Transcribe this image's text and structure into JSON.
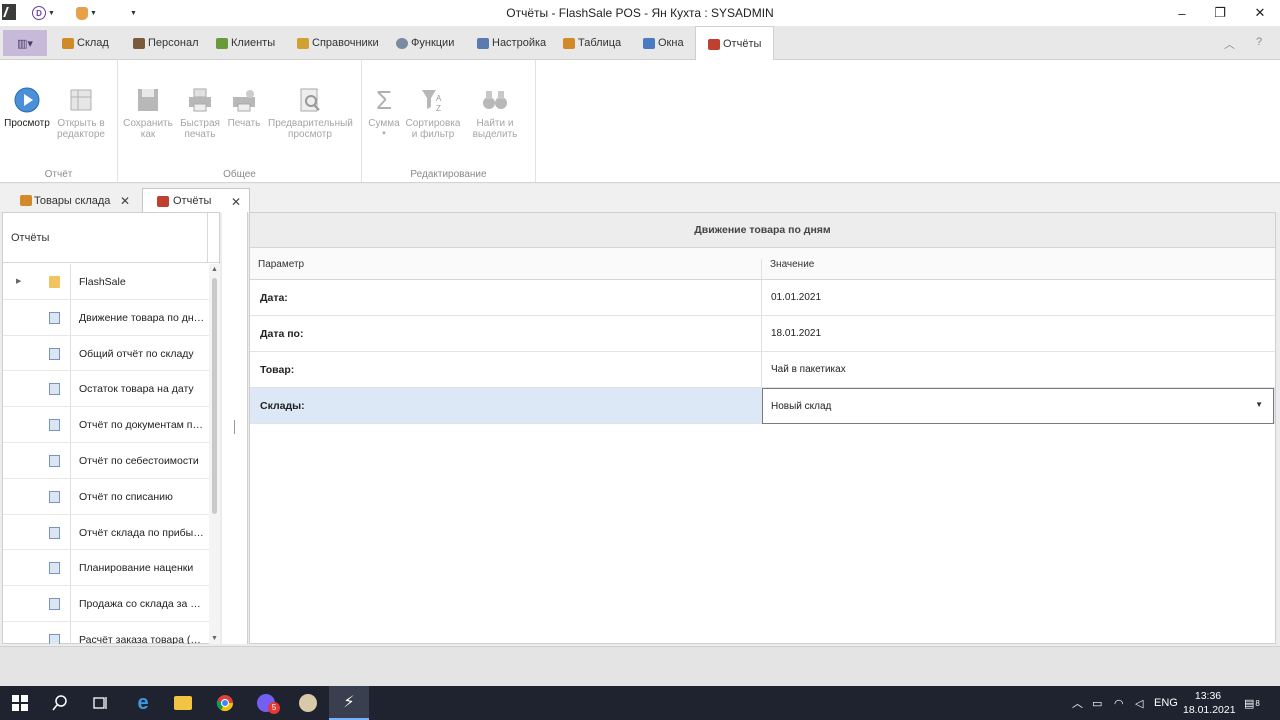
{
  "window": {
    "title": "Отчёты - FlashSale POS - Ян Кухта : SYSADMIN",
    "minimize_glyph": "–",
    "maximize_glyph": "❐",
    "close_glyph": "✕",
    "qat_badge": "D"
  },
  "ribbon": {
    "tabs": [
      {
        "label": "Склад",
        "icon": "warehouse-icon",
        "color": "#d08a2a"
      },
      {
        "label": "Персонал",
        "icon": "person-icon",
        "color": "#7a5a3a"
      },
      {
        "label": "Клиенты",
        "icon": "clients-icon",
        "color": "#6a9a3a"
      },
      {
        "label": "Справочники",
        "icon": "book-icon",
        "color": "#d0a030"
      },
      {
        "label": "Функции",
        "icon": "gear-icon",
        "color": "#7a8aa0"
      },
      {
        "label": "Настройка",
        "icon": "settings-icon",
        "color": "#5a7ab0"
      },
      {
        "label": "Таблица",
        "icon": "table-icon",
        "color": "#d08a2a"
      },
      {
        "label": "Окна",
        "icon": "windows-icon",
        "color": "#4a7ac0"
      },
      {
        "label": "Отчёты",
        "icon": "reports-icon",
        "color": "#c04030"
      }
    ],
    "right_buttons": [
      "collapse-ribbon-icon",
      "help-icon"
    ],
    "groups": [
      {
        "caption": "Отчёт",
        "buttons": [
          {
            "label": "Просмотр",
            "enabled": true,
            "icon": "play-icon"
          },
          {
            "label": "Открыть в редакторе",
            "enabled": false,
            "icon": "editor-icon"
          }
        ]
      },
      {
        "caption": "Общее",
        "buttons": [
          {
            "label": "Сохранить как",
            "enabled": false,
            "icon": "save-icon"
          },
          {
            "label": "Быстрая печать",
            "enabled": false,
            "icon": "quick-print-icon"
          },
          {
            "label": "Печать",
            "enabled": false,
            "icon": "print-icon"
          },
          {
            "label": "Предварительный просмотр",
            "enabled": false,
            "icon": "preview-icon"
          }
        ]
      },
      {
        "caption": "Редактирование",
        "buttons": [
          {
            "label": "Сумма",
            "enabled": false,
            "icon": "sigma-icon"
          },
          {
            "label": "Сортировка и фильтр",
            "enabled": false,
            "icon": "sort-filter-icon"
          },
          {
            "label": "Найти и выделить",
            "enabled": false,
            "icon": "binoculars-icon"
          }
        ]
      }
    ]
  },
  "doc_tabs": [
    {
      "label": "Товары склада",
      "active": false
    },
    {
      "label": "Отчёты",
      "active": true
    }
  ],
  "reports_panel": {
    "header": "Отчёты",
    "items": [
      {
        "label": "FlashSale",
        "type": "folder"
      },
      {
        "label": "Движение товара по дням",
        "type": "report"
      },
      {
        "label": "Общий отчёт по складу",
        "type": "report"
      },
      {
        "label": "Остаток товара на дату",
        "type": "report"
      },
      {
        "label": "Отчёт по документам пос...",
        "type": "report"
      },
      {
        "label": "Отчёт по себестоимости",
        "type": "report"
      },
      {
        "label": "Отчёт по списанию",
        "type": "report"
      },
      {
        "label": "Отчёт склада по прибыли",
        "type": "report"
      },
      {
        "label": "Планирование наценки",
        "type": "report"
      },
      {
        "label": "Продажа со склада за пе...",
        "type": "report"
      },
      {
        "label": "Расчёт заказа товара (пр...",
        "type": "report"
      }
    ]
  },
  "params_grid": {
    "title": "Движение товара по дням",
    "col_param": "Параметр",
    "col_value": "Значение",
    "rows": [
      {
        "key": "Дата:",
        "value": "01.01.2021"
      },
      {
        "key": "Дата по:",
        "value": "18.01.2021"
      },
      {
        "key": "Товар:",
        "value": "Чай в пакетиках"
      },
      {
        "key": "Склады:",
        "value": "Новый склад"
      }
    ]
  },
  "taskbar": {
    "lang": "ENG",
    "time": "13:36",
    "date": "18.01.2021",
    "viber_badge": "5",
    "notifications": "8"
  }
}
